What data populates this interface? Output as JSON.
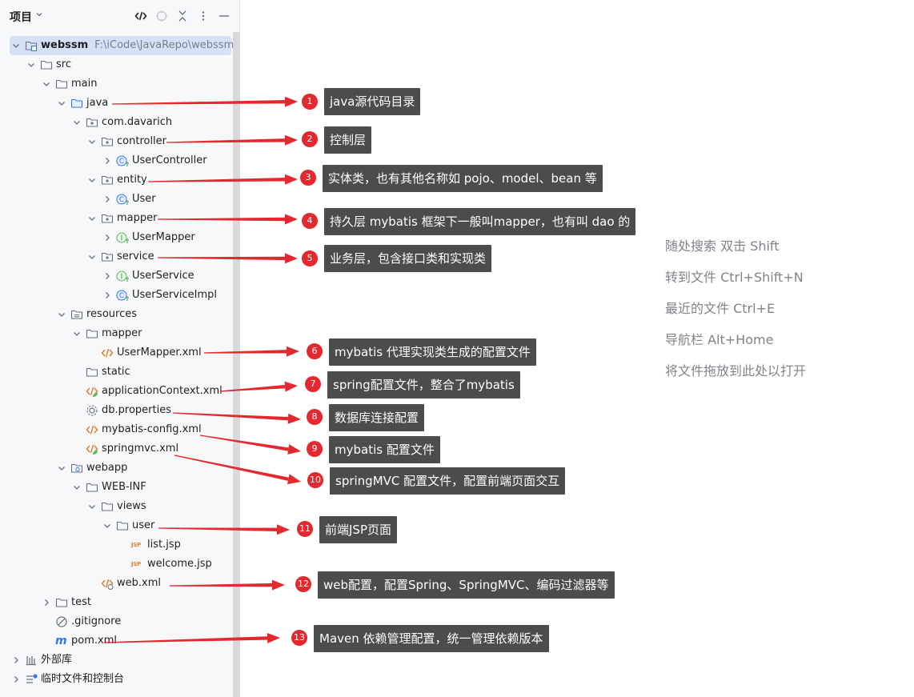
{
  "panel": {
    "title": "项目"
  },
  "tree": [
    {
      "id": "webssm",
      "label": "webssm",
      "path": "F:\\iCode\\JavaRepo\\webssm",
      "depth": 0,
      "chevron": "down",
      "icon": "module-icon",
      "selected": true
    },
    {
      "id": "src",
      "label": "src",
      "depth": 1,
      "chevron": "down",
      "icon": "folder-icon"
    },
    {
      "id": "main",
      "label": "main",
      "depth": 2,
      "chevron": "down",
      "icon": "folder-icon"
    },
    {
      "id": "java",
      "label": "java",
      "depth": 3,
      "chevron": "down",
      "icon": "source-folder-icon"
    },
    {
      "id": "com-davarich",
      "label": "com.davarich",
      "depth": 4,
      "chevron": "down",
      "icon": "package-icon"
    },
    {
      "id": "controller",
      "label": "controller",
      "depth": 5,
      "chevron": "down",
      "icon": "package-icon"
    },
    {
      "id": "usercontroller",
      "label": "UserController",
      "depth": 6,
      "chevron": "right",
      "icon": "class-icon"
    },
    {
      "id": "entity",
      "label": "entity",
      "depth": 5,
      "chevron": "down",
      "icon": "package-icon"
    },
    {
      "id": "user-class",
      "label": "User",
      "depth": 6,
      "chevron": "right",
      "icon": "class-icon"
    },
    {
      "id": "mapper-pkg",
      "label": "mapper",
      "depth": 5,
      "chevron": "down",
      "icon": "package-icon"
    },
    {
      "id": "usermapper",
      "label": "UserMapper",
      "depth": 6,
      "chevron": "right",
      "icon": "interface-icon"
    },
    {
      "id": "service",
      "label": "service",
      "depth": 5,
      "chevron": "down",
      "icon": "package-icon"
    },
    {
      "id": "userservice",
      "label": "UserService",
      "depth": 6,
      "chevron": "right",
      "icon": "interface-icon"
    },
    {
      "id": "userserviceimpl",
      "label": "UserServiceImpl",
      "depth": 6,
      "chevron": "right",
      "icon": "class-icon"
    },
    {
      "id": "resources",
      "label": "resources",
      "depth": 3,
      "chevron": "down",
      "icon": "resources-folder-icon"
    },
    {
      "id": "mapper-res",
      "label": "mapper",
      "depth": 4,
      "chevron": "down",
      "icon": "folder-icon"
    },
    {
      "id": "usermapper-xml",
      "label": "UserMapper.xml",
      "depth": 5,
      "chevron": "none",
      "icon": "xml-icon"
    },
    {
      "id": "static",
      "label": "static",
      "depth": 4,
      "chevron": "none",
      "icon": "folder-icon"
    },
    {
      "id": "appctx",
      "label": "applicationContext.xml",
      "depth": 4,
      "chevron": "none",
      "icon": "spring-xml-icon"
    },
    {
      "id": "dbprops",
      "label": "db.properties",
      "depth": 4,
      "chevron": "none",
      "icon": "properties-icon"
    },
    {
      "id": "mybatis-config",
      "label": "mybatis-config.xml",
      "depth": 4,
      "chevron": "none",
      "icon": "xml-icon"
    },
    {
      "id": "springmvc",
      "label": "springmvc.xml",
      "depth": 4,
      "chevron": "none",
      "icon": "spring-xml-icon"
    },
    {
      "id": "webapp",
      "label": "webapp",
      "depth": 3,
      "chevron": "down",
      "icon": "web-folder-icon"
    },
    {
      "id": "web-inf",
      "label": "WEB-INF",
      "depth": 4,
      "chevron": "down",
      "icon": "folder-icon"
    },
    {
      "id": "views",
      "label": "views",
      "depth": 5,
      "chevron": "down",
      "icon": "folder-icon"
    },
    {
      "id": "user-folder",
      "label": "user",
      "depth": 6,
      "chevron": "down",
      "icon": "folder-icon"
    },
    {
      "id": "list-jsp",
      "label": "list.jsp",
      "depth": 7,
      "chevron": "none",
      "icon": "jsp-icon"
    },
    {
      "id": "welcome-jsp",
      "label": "welcome.jsp",
      "depth": 7,
      "chevron": "none",
      "icon": "jsp-icon"
    },
    {
      "id": "web-xml",
      "label": "web.xml",
      "depth": 5,
      "chevron": "none",
      "icon": "web-xml-icon"
    },
    {
      "id": "test",
      "label": "test",
      "depth": 2,
      "chevron": "right",
      "icon": "folder-icon"
    },
    {
      "id": "gitignore",
      "label": ".gitignore",
      "depth": 2,
      "chevron": "none",
      "icon": "ignore-icon"
    },
    {
      "id": "pom",
      "label": "pom.xml",
      "depth": 2,
      "chevron": "none",
      "icon": "maven-icon"
    },
    {
      "id": "ext-libs",
      "label": "外部库",
      "depth": 0,
      "chevron": "right",
      "icon": "library-icon"
    },
    {
      "id": "scratches",
      "label": "临时文件和控制台",
      "depth": 0,
      "chevron": "right",
      "icon": "scratches-icon"
    }
  ],
  "annotations": [
    {
      "num": "1",
      "text": "java源代码目录"
    },
    {
      "num": "2",
      "text": "控制层"
    },
    {
      "num": "3",
      "text": "实体类，也有其他名称如 pojo、model、bean 等"
    },
    {
      "num": "4",
      "text": "持久层 mybatis 框架下一般叫mapper，也有叫 dao 的"
    },
    {
      "num": "5",
      "text": "业务层，包含接口类和实现类"
    },
    {
      "num": "6",
      "text": "mybatis 代理实现类生成的配置文件"
    },
    {
      "num": "7",
      "text": "spring配置文件，整合了mybatis"
    },
    {
      "num": "8",
      "text": "数据库连接配置"
    },
    {
      "num": "9",
      "text": "mybatis 配置文件"
    },
    {
      "num": "10",
      "text": "springMVC 配置文件，配置前端页面交互"
    },
    {
      "num": "11",
      "text": "前端JSP页面"
    },
    {
      "num": "12",
      "text": "web配置，配置Spring、SpringMVC、编码过滤器等"
    },
    {
      "num": "13",
      "text": "Maven 依赖管理配置，统一管理依赖版本"
    }
  ],
  "hints": [
    "随处搜索 双击 Shift",
    "转到文件 Ctrl+Shift+N",
    "最近的文件 Ctrl+E",
    "导航栏 Alt+Home",
    "将文件拖放到此处以打开"
  ],
  "colors": {
    "accent": "#3574f0",
    "annotation_red": "#e3292f",
    "callout_bg": "#4c4c4c",
    "selection": "#d5e1f7"
  }
}
